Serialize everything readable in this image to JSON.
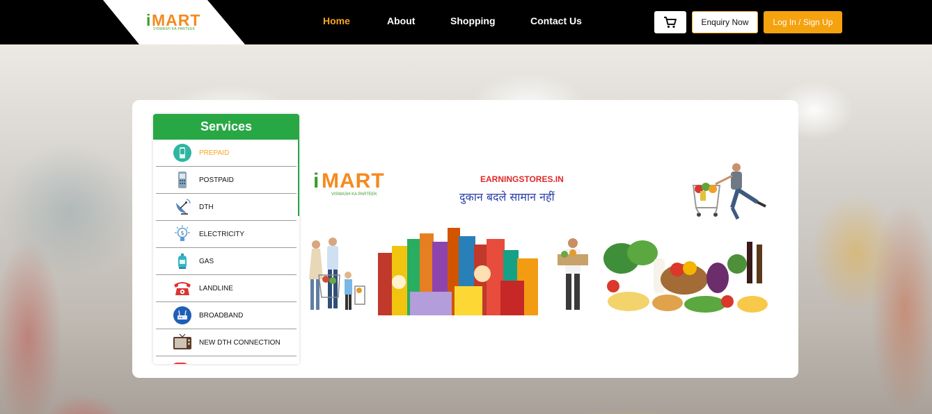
{
  "nav": {
    "logo": {
      "initial": "i",
      "name": "MART",
      "tagline": "VISWASH KA PARTEEK"
    },
    "links": [
      {
        "label": "Home",
        "active": true
      },
      {
        "label": "About",
        "active": false
      },
      {
        "label": "Shopping",
        "active": false
      },
      {
        "label": "Contact Us",
        "active": false
      }
    ],
    "cart_icon": "cart-icon",
    "enquiry_label": "Enquiry Now",
    "login_label": "Log In / Sign Up"
  },
  "services": {
    "title": "Services",
    "items": [
      {
        "label": "PREPAID",
        "icon": "mobile-icon",
        "active": true
      },
      {
        "label": "POSTPAID",
        "icon": "phone-icon",
        "active": false
      },
      {
        "label": "DTH",
        "icon": "satellite-dish-icon",
        "active": false
      },
      {
        "label": "ELECTRICITY",
        "icon": "bulb-icon",
        "active": false
      },
      {
        "label": "GAS",
        "icon": "gas-cylinder-icon",
        "active": false
      },
      {
        "label": "LANDLINE",
        "icon": "landline-icon",
        "active": false
      },
      {
        "label": "BROADBAND",
        "icon": "router-icon",
        "active": false
      },
      {
        "label": "NEW DTH CONNECTION",
        "icon": "tv-icon",
        "active": false
      }
    ]
  },
  "banner": {
    "logo": {
      "initial": "i",
      "name": "MART",
      "tagline": "VISWASH KA PARTEEK"
    },
    "site": "EARNINGSTORES.IN",
    "tagline": "दुकान बदले सामान नहीं"
  },
  "colors": {
    "accent": "#f5a623",
    "green": "#28a745",
    "navbar": "#000000"
  }
}
